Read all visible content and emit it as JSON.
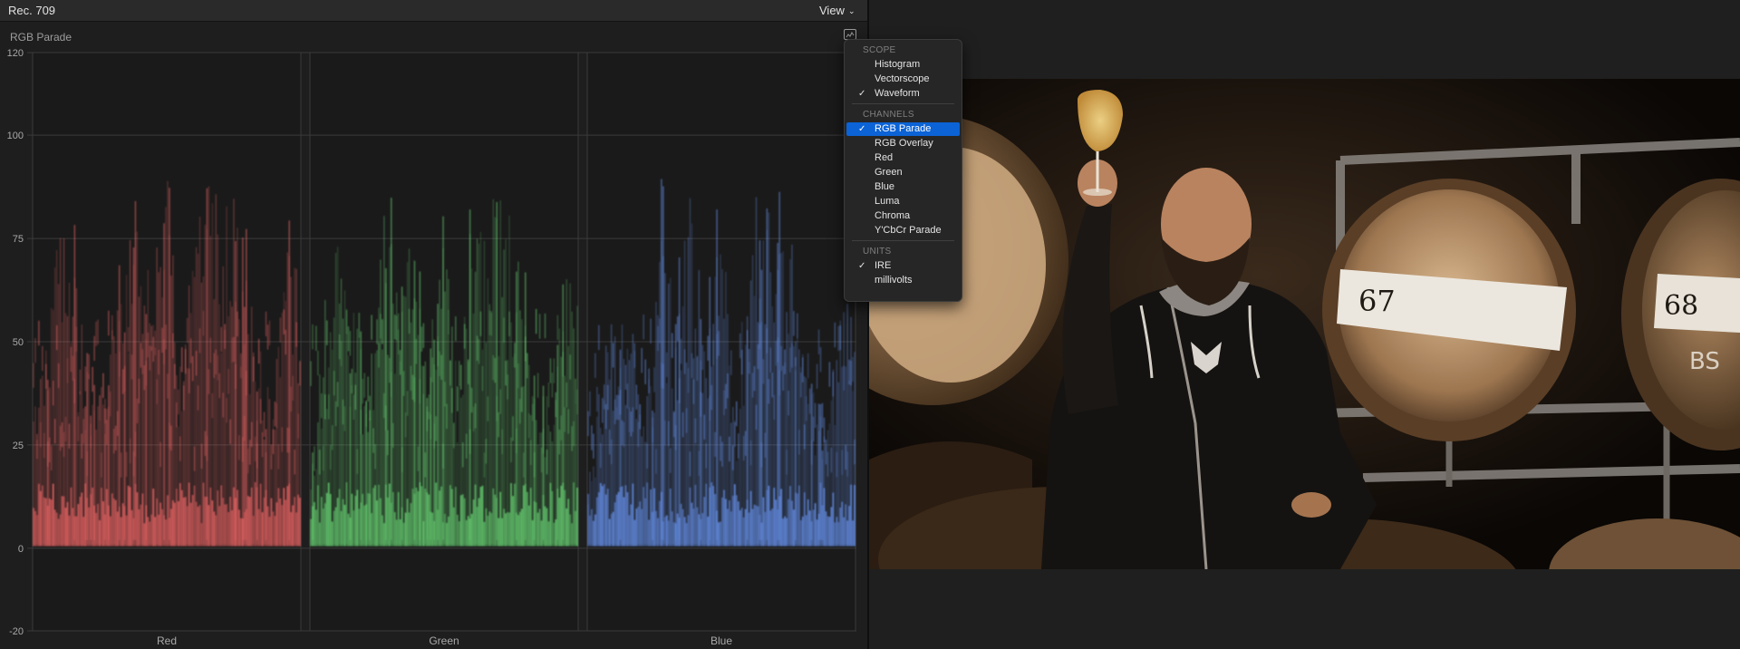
{
  "header": {
    "color_space": "Rec. 709",
    "view_menu_label": "View"
  },
  "scope": {
    "title": "RGB Parade"
  },
  "colors": {
    "red_trace": "#ff6b6b",
    "green_trace": "#6ee27a",
    "blue_trace": "#6d9cff",
    "menu_highlight": "#0b63d6"
  },
  "chart_data": {
    "type": "waveform",
    "units": "IRE",
    "ylim": [
      -20,
      120
    ],
    "y_ticks": [
      120,
      100,
      75,
      50,
      25,
      0,
      -20
    ],
    "panels": [
      {
        "name": "Red",
        "color": "#ff6b6b"
      },
      {
        "name": "Green",
        "color": "#6ee27a"
      },
      {
        "name": "Blue",
        "color": "#6d9cff"
      }
    ],
    "peaks": {
      "Red": [
        30,
        55,
        80,
        60,
        40,
        45,
        70,
        95,
        60,
        90,
        40,
        85,
        84,
        82,
        80,
        50,
        38,
        70,
        65
      ],
      "Green": [
        20,
        60,
        75,
        55,
        45,
        88,
        60,
        92,
        50,
        80,
        40,
        85,
        84,
        80,
        78,
        48,
        35,
        62,
        63
      ],
      "Blue": [
        15,
        45,
        60,
        50,
        40,
        75,
        55,
        88,
        48,
        78,
        35,
        82,
        80,
        78,
        76,
        45,
        30,
        55,
        60
      ]
    }
  },
  "menu": {
    "sections": [
      {
        "header": "SCOPE",
        "items": [
          {
            "label": "Histogram",
            "checked": false
          },
          {
            "label": "Vectorscope",
            "checked": false
          },
          {
            "label": "Waveform",
            "checked": true
          }
        ]
      },
      {
        "header": "CHANNELS",
        "items": [
          {
            "label": "RGB Parade",
            "checked": true,
            "highlighted": true
          },
          {
            "label": "RGB Overlay",
            "checked": false
          },
          {
            "label": "Red",
            "checked": false
          },
          {
            "label": "Green",
            "checked": false
          },
          {
            "label": "Blue",
            "checked": false
          },
          {
            "label": "Luma",
            "checked": false
          },
          {
            "label": "Chroma",
            "checked": false
          },
          {
            "label": "Y'CbCr Parade",
            "checked": false
          }
        ]
      },
      {
        "header": "UNITS",
        "items": [
          {
            "label": "IRE",
            "checked": true
          },
          {
            "label": "millivolts",
            "checked": false
          }
        ]
      }
    ]
  },
  "viewer": {
    "barrel_numbers": [
      "67",
      "68"
    ],
    "barrel_markings": [
      "BS"
    ]
  }
}
